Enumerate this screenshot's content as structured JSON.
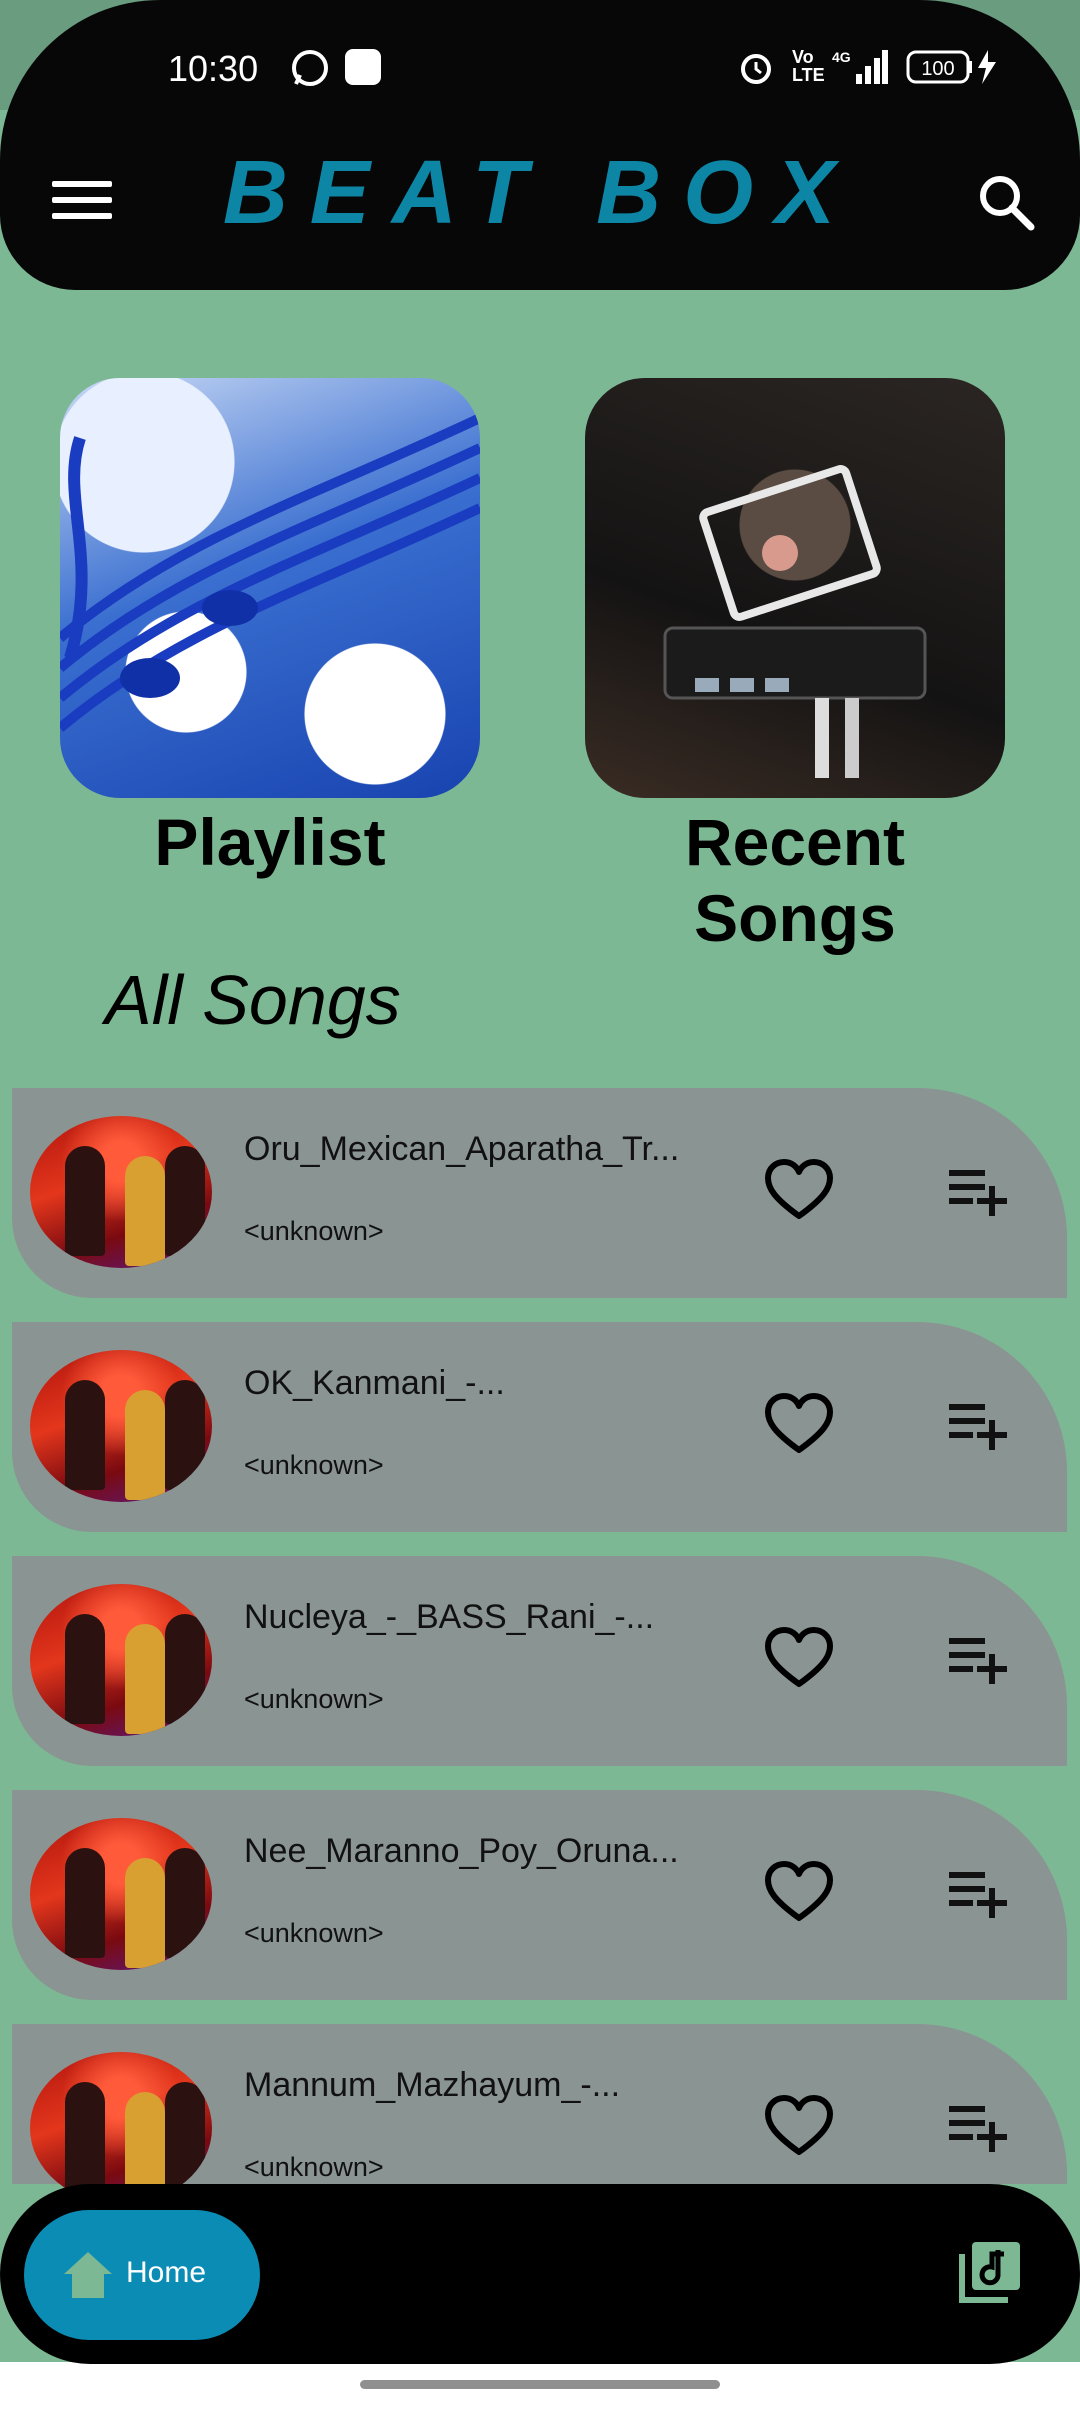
{
  "status_bar": {
    "time": "10:30",
    "battery": "100"
  },
  "header": {
    "title": "BEAT BOX"
  },
  "cards": [
    {
      "label": "Playlist"
    },
    {
      "label": "Recent Songs"
    }
  ],
  "section": {
    "title": "All Songs"
  },
  "songs": [
    {
      "title": "Oru_Mexican_Aparatha_Tr...",
      "artist": "<unknown>"
    },
    {
      "title": "OK_Kanmani_-...",
      "artist": "<unknown>"
    },
    {
      "title": "Nucleya_-_BASS_Rani_-...",
      "artist": "<unknown>"
    },
    {
      "title": "Nee_Maranno_Poy_Oruna...",
      "artist": "<unknown>"
    },
    {
      "title": "Mannum_Mazhayum_-...",
      "artist": "<unknown>"
    }
  ],
  "bottom_nav": {
    "home_label": "Home"
  },
  "colors": {
    "accent": "#0a8cb5",
    "title": "#0d86a6",
    "background": "#7db894"
  }
}
